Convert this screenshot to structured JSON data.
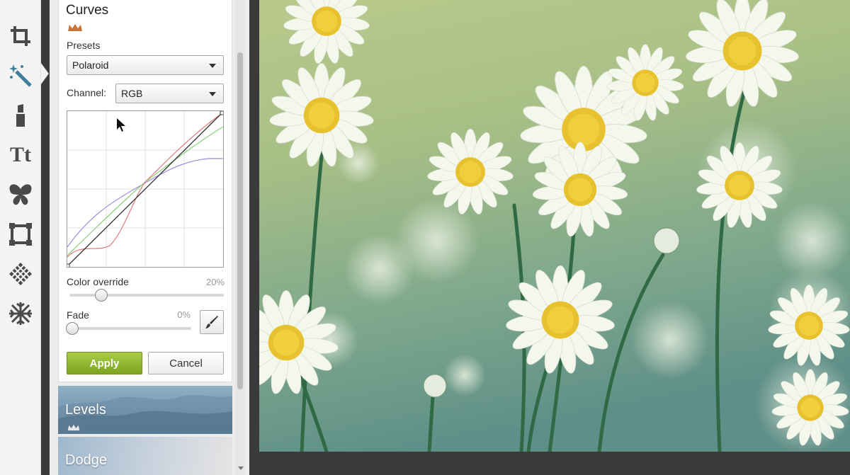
{
  "tool_rail": {
    "tools": [
      {
        "icon": "crop-icon"
      },
      {
        "icon": "magic-wand-icon",
        "active": true
      },
      {
        "icon": "lipstick-icon"
      },
      {
        "icon": "text-icon",
        "glyph": "Tt"
      },
      {
        "icon": "butterfly-icon"
      },
      {
        "icon": "frame-icon"
      },
      {
        "icon": "texture-icon"
      },
      {
        "icon": "snowflake-icon"
      }
    ]
  },
  "curves_panel": {
    "title": "Curves",
    "premium_icon": "crown-icon",
    "presets_label": "Presets",
    "preset_value": "Polaroid",
    "channel_label": "Channel:",
    "channel_value": "RGB",
    "color_override_label": "Color override",
    "color_override_value": "20%",
    "color_override_level": 0.2,
    "fade_label": "Fade",
    "fade_value": "0%",
    "fade_level": 0.0,
    "apply_label": "Apply",
    "cancel_label": "Cancel",
    "curve_colors": {
      "rgb": "#333333",
      "red": "#e07a7a",
      "green": "#8ccf7a",
      "blue": "#9a8fe0"
    }
  },
  "effect_tiles": [
    {
      "label": "Levels",
      "premium": true
    },
    {
      "label": "Dodge"
    }
  ],
  "accent_colors": {
    "apply": "#8db733",
    "crown": "#c8733a"
  }
}
